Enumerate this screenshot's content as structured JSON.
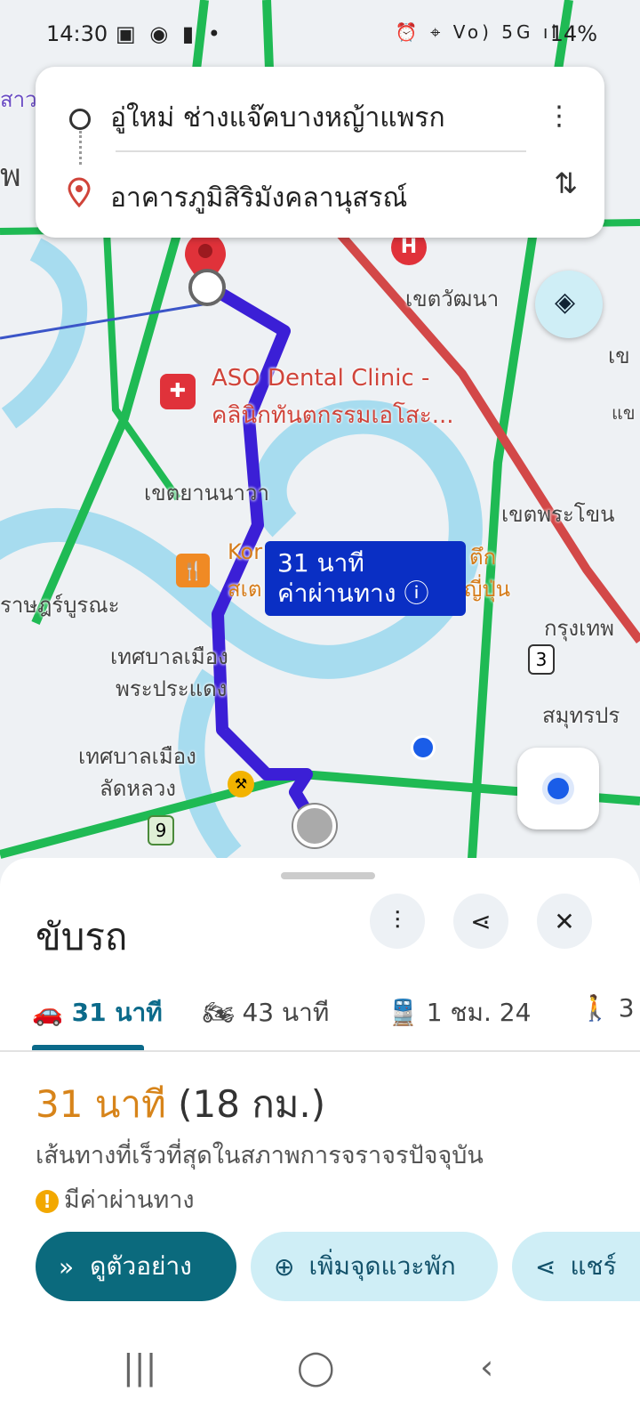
{
  "status_bar": {
    "time": "14:30",
    "left_icons": "▣ ◉ ▮ •",
    "right_icons": "⏰ ⌖ Vo) 5G ıl",
    "battery": "14%"
  },
  "route": {
    "origin": "อู่ใหม่ ช่างแจ๊คบางหญ้าแพรก",
    "destination": "อาคารภูมิสิริมังคลานุสรณ์",
    "more_icon": "⋮",
    "swap_icon": "⇅"
  },
  "map": {
    "labels": {
      "hospital_area": "เขตวัฒนา",
      "poi_name1": "ASO Dental Clinic -",
      "poi_name2": "คลินิกทันตกรรมเอโสะ...",
      "yannawa": "เขตยานนาวา",
      "phra_khanong": "เขตพระโขน",
      "rat_burana": "ราษฎร์บูรณะ",
      "phra_pradaeng1": "เทศบาลเมือง",
      "phra_pradaeng2": "พระประแดง",
      "lat_luang1": "เทศบาลเมือง",
      "lat_luang2": "ลัดหลวง",
      "krung_thep": "กรุงเทพ",
      "samut": "สมุทรปร",
      "restaurant_a": "Kor",
      "restaurant_b": "สเต",
      "restaurant_c": "ตึก",
      "restaurant_d": "ญี่ปุ่น",
      "route_3": "3",
      "route_9": "9",
      "edge_top_left": "สาว",
      "edge_left": "พ",
      "edge_right1": "เข",
      "edge_right2": "แข"
    },
    "eta": {
      "time": "31 นาที",
      "toll": "ค่าผ่านทาง ⓘ"
    }
  },
  "sheet": {
    "title": "ขับรถ",
    "filter_icon": "⫶",
    "share_icon": "⋖",
    "close_icon": "✕",
    "modes": [
      {
        "icon": "🚗",
        "label": "31 นาที"
      },
      {
        "icon": "🏍",
        "label": "43 นาที"
      },
      {
        "icon": "🚆",
        "label": "1 ชม. 24"
      },
      {
        "icon": "🚶",
        "label": "3"
      }
    ],
    "duration": "31 นาที",
    "distance": "(18 กม.)",
    "description": "เส้นทางที่เร็วที่สุดในสภาพการจราจรปัจจุบัน",
    "toll_note": "มีค่าผ่านทาง",
    "toll_icon": "!",
    "actions": {
      "preview_icon": "»",
      "preview": "ดูตัวอย่าง",
      "add_stop_icon": "⊕",
      "add_stop": "เพิ่มจุดแวะพัก",
      "share_icon": "⋖",
      "share": "แชร์"
    }
  },
  "nav_bar": {
    "recent": "|||",
    "home": "◯",
    "back": "‹"
  },
  "colors": {
    "route": "#3b1fd6",
    "accent": "#0b6a7d",
    "duration": "#d7841a",
    "road_green": "#1fba54"
  }
}
